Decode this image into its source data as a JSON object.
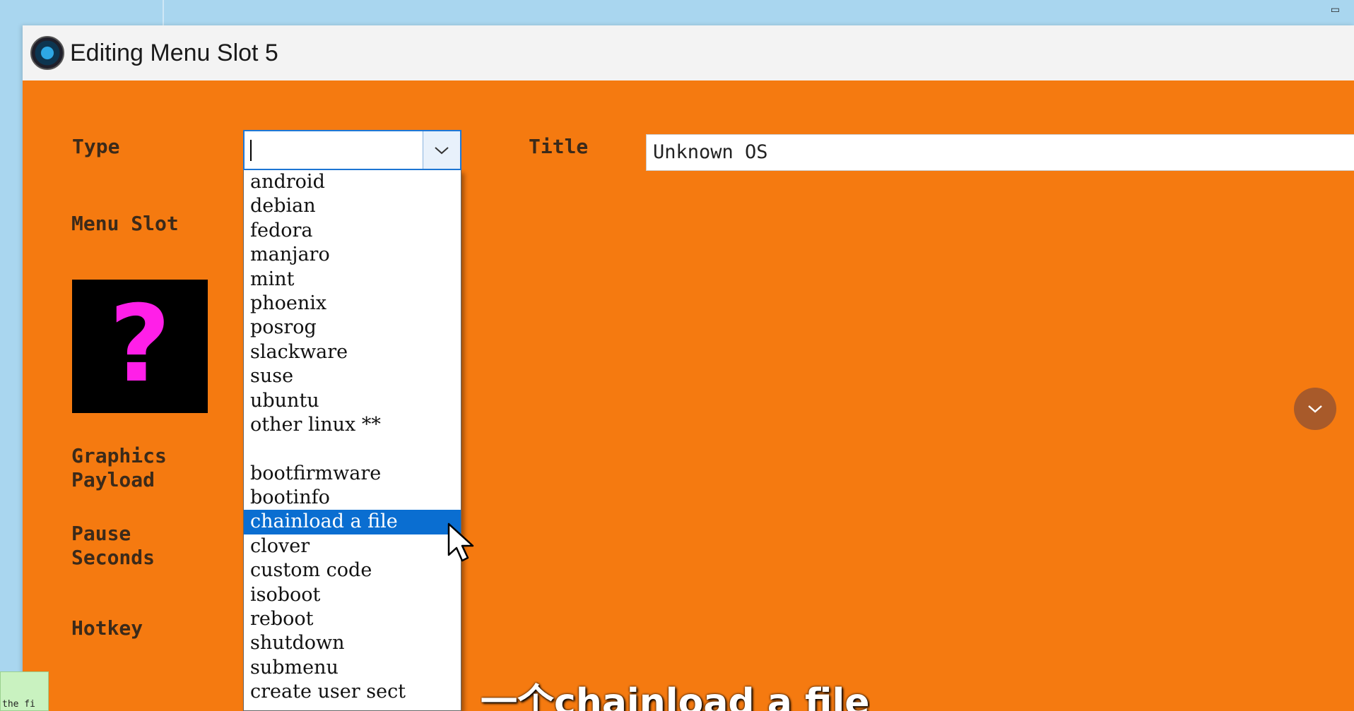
{
  "window": {
    "title": "Editing Menu Slot 5",
    "background_color": "#f57a10"
  },
  "form": {
    "type_label": "Type",
    "menu_slot_label": "Menu Slot",
    "graphics_payload_label": "Graphics\nPayload",
    "pause_seconds_label": "Pause\nSeconds",
    "hotkey_label": "Hotkey",
    "title_label": "Title",
    "title_value": "Unknown OS",
    "type_value": "",
    "icon_glyph": "?",
    "icon_color": "#ff1fe8"
  },
  "type_dropdown": {
    "items": [
      "android",
      "debian",
      "fedora",
      "manjaro",
      "mint",
      "phoenix",
      "posrog",
      "slackware",
      "suse",
      "ubuntu",
      "other linux **",
      "",
      "bootfirmware",
      "bootinfo",
      "chainload a file",
      "clover",
      "custom code",
      "isoboot",
      "reboot",
      "shutdown",
      "submenu",
      "create user sect"
    ],
    "selected": "chainload a file",
    "selected_color": "#0a6ed1"
  },
  "status_chip": {
    "text": "the fi"
  },
  "subtitle": {
    "text": "一个chainload a file"
  },
  "icons": {
    "app": "app-logo-icon",
    "combo_arrow": "chevron-down-icon",
    "scroll": "chevron-down-icon",
    "cursor": "mouse-pointer-icon"
  }
}
